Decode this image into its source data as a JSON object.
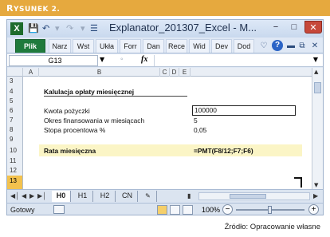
{
  "figure": {
    "label_prefix": "R",
    "label_rest": "YSUNEK 2.",
    "source": "Źródło: Opracowanie własne"
  },
  "window": {
    "app_icon": "X",
    "title": "Explanator_201307_Excel - M...",
    "quick_access": [
      "save-icon",
      "undo-icon",
      "redo-icon",
      "customize-icon"
    ],
    "controls": {
      "minimize": "−",
      "maximize": "□",
      "close": "✕"
    }
  },
  "ribbon": {
    "tabs": [
      "Plik",
      "Narz",
      "Wst",
      "Ukła",
      "Forr",
      "Dan",
      "Rece",
      "Wid",
      "Dev",
      "Dod"
    ],
    "icons": [
      "heart-icon",
      "help-icon",
      "minimize-ribbon-icon",
      "restore-icon",
      "close-icon"
    ]
  },
  "formula_bar": {
    "name_box": "G13",
    "fx": "fx",
    "content": ""
  },
  "columns": [
    "A",
    "B",
    "C",
    "D",
    "E"
  ],
  "rows": [
    "3",
    "4",
    "5",
    "6",
    "7",
    "8",
    "9",
    "10",
    "11",
    "12",
    "13"
  ],
  "active_row": "13",
  "cells": {
    "title": "Kalulacja opłaty miesięcznej",
    "loan_label": "Kwota pożyczki",
    "loan_value": "100000",
    "months_label": "Okres finansowania w miesiącach",
    "months_value": "5",
    "rate_label": "Stopa procentowa %",
    "rate_value": "0,05",
    "payment_label": "Rata miesięczna",
    "payment_formula": "=PMT(F8/12;F7;F6)"
  },
  "sheets": [
    "H0",
    "H1",
    "H2",
    "CN"
  ],
  "active_sheet": "H0",
  "status": {
    "ready": "Gotowy",
    "zoom": "100%"
  }
}
